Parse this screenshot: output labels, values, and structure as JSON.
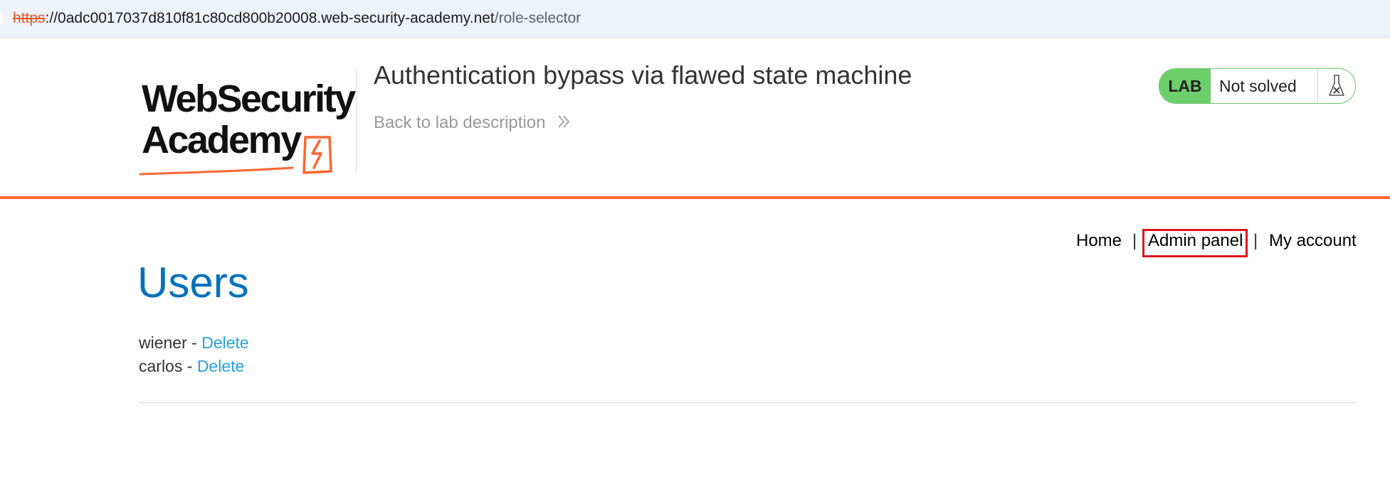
{
  "browser": {
    "url_scheme": "https",
    "url_host": "://0adc0017037d810f81c80cd800b20008.web-security-academy.net",
    "url_path": "/role-selector"
  },
  "header": {
    "logo_line1": "WebSecurity",
    "logo_line2": "Academy",
    "lab_title": "Authentication bypass via flawed state machine",
    "back_link": "Back to lab description",
    "status_badge": "LAB",
    "status_text": "Not solved",
    "status_icon": "flask-icon"
  },
  "nav": {
    "home": "Home",
    "separator": "|",
    "admin_panel": "Admin panel",
    "my_account": "My account"
  },
  "main": {
    "title": "Users",
    "users": [
      {
        "name": "wiener",
        "separator": " - ",
        "action": "Delete"
      },
      {
        "name": "carlos",
        "separator": " - ",
        "action": "Delete"
      }
    ]
  },
  "colors": {
    "accent_orange": "#ff6633",
    "link_blue": "#29a0e0",
    "heading_blue": "#0071bc",
    "status_green": "#6ccf6c",
    "highlight_red": "#e0141e"
  }
}
